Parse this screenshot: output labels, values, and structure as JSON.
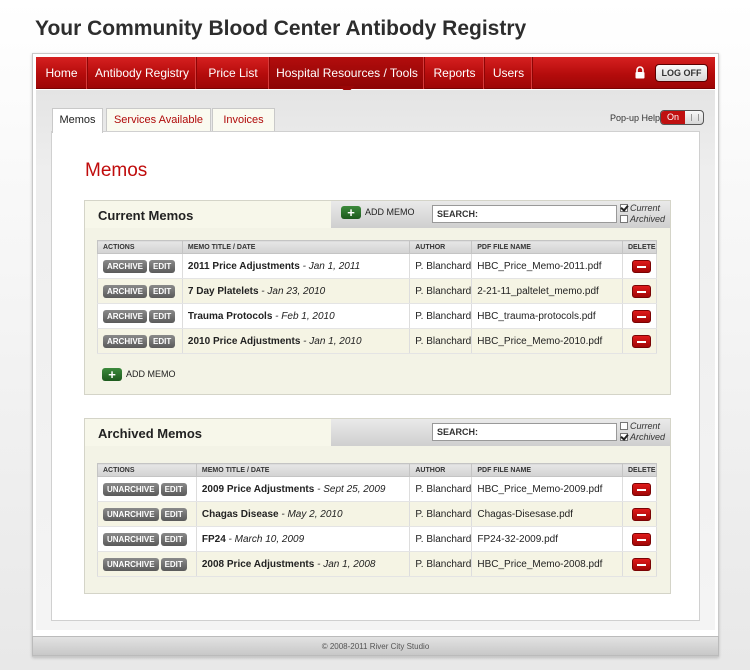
{
  "page_title": "Your Community Blood Center Antibody Registry",
  "nav": {
    "items": [
      "Home",
      "Antibody Registry",
      "Price List",
      "Hospital Resources / Tools",
      "Reports",
      "Users"
    ],
    "active": "Hospital Resources / Tools",
    "logoff_label": "LOG OFF"
  },
  "tabs": [
    "Memos",
    "Services Available",
    "Invoices"
  ],
  "popup_help": {
    "label": "Pop-up Help",
    "state": "On"
  },
  "heading": "Memos",
  "current": {
    "title": "Current Memos",
    "add_label": "ADD MEMO",
    "search_label": "SEARCH:",
    "filters": {
      "current": "Current",
      "archived": "Archived"
    },
    "columns": [
      "ACTIONS",
      "MEMO TITLE / DATE",
      "AUTHOR",
      "PDF FILE NAME",
      "DELETE"
    ],
    "rows": [
      {
        "archive": "ARCHIVE",
        "edit": "EDIT",
        "title": "2011 Price Adjustments",
        "date": " - Jan 1, 2011",
        "author": "P. Blanchard",
        "file": "HBC_Price_Memo-2011.pdf"
      },
      {
        "archive": "ARCHIVE",
        "edit": "EDIT",
        "title": "7 Day Platelets",
        "date": " - Jan 23, 2010",
        "author": "P. Blanchard",
        "file": "2-21-11_paltelet_memo.pdf"
      },
      {
        "archive": "ARCHIVE",
        "edit": "EDIT",
        "title": "Trauma Protocols",
        "date": " - Feb 1, 2010",
        "author": "P. Blanchard",
        "file": "HBC_trauma-protocols.pdf"
      },
      {
        "archive": "ARCHIVE",
        "edit": "EDIT",
        "title": "2010 Price Adjustments",
        "date": " - Jan 1, 2010",
        "author": "P. Blanchard",
        "file": "HBC_Price_Memo-2010.pdf"
      }
    ]
  },
  "archived": {
    "title": "Archived Memos",
    "search_label": "SEARCH:",
    "filters": {
      "current": "Current",
      "archived": "Archived"
    },
    "columns": [
      "ACTIONS",
      "MEMO TITLE / DATE",
      "AUTHOR",
      "PDF FILE NAME",
      "DELETE"
    ],
    "rows": [
      {
        "unarchive": "UNARCHIVE",
        "edit": "EDIT",
        "title": "2009 Price Adjustments",
        "date": " - Sept 25, 2009",
        "author": "P. Blanchard",
        "file": "HBC_Price_Memo-2009.pdf"
      },
      {
        "unarchive": "UNARCHIVE",
        "edit": "EDIT",
        "title": "Chagas Disease",
        "date": " - May 2, 2010",
        "author": "P. Blanchard",
        "file": "Chagas-Disesase.pdf"
      },
      {
        "unarchive": "UNARCHIVE",
        "edit": "EDIT",
        "title": "FP24",
        "date": " - March 10, 2009",
        "author": "P. Blanchard",
        "file": "FP24-32-2009.pdf"
      },
      {
        "unarchive": "UNARCHIVE",
        "edit": "EDIT",
        "title": "2008 Price Adjustments",
        "date": " - Jan 1, 2008",
        "author": "P. Blanchard",
        "file": "HBC_Price_Memo-2008.pdf"
      }
    ]
  },
  "footer": "© 2008-2011 River City Studio",
  "colors": {
    "brand_red": "#b50c0c",
    "add_green": "#2a7a2a"
  }
}
